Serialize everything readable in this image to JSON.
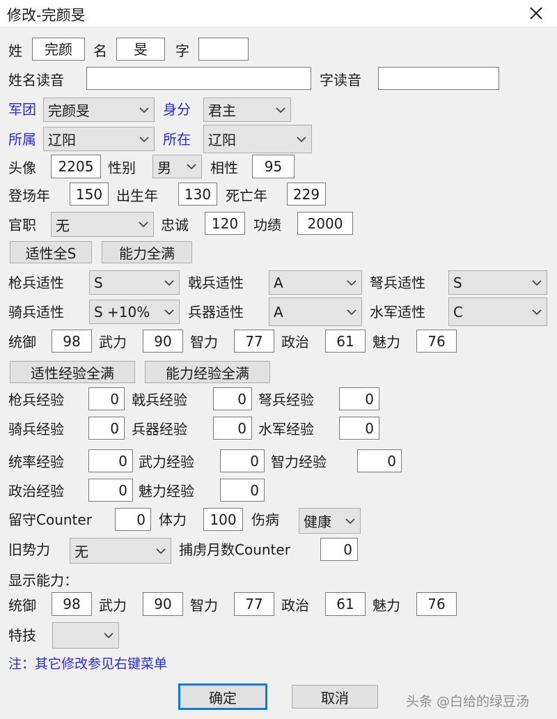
{
  "window": {
    "title": "修改-完颜旻",
    "close_icon": "close-icon"
  },
  "name_row": {
    "surname_label": "姓",
    "surname_value": "完颜",
    "given_label": "名",
    "given_value": "旻",
    "courtesy_label": "字",
    "courtesy_value": ""
  },
  "pronunciation_row": {
    "name_reading_label": "姓名读音",
    "name_reading_value": "",
    "courtesy_reading_label": "字读音",
    "courtesy_reading_value": ""
  },
  "affiliation": {
    "corps_label": "军团",
    "corps_value": "完颜旻",
    "identity_label": "身分",
    "identity_value": "君主",
    "belong_label": "所属",
    "belong_value": "辽阳",
    "location_label": "所在",
    "location_value": "辽阳"
  },
  "portrait_row": {
    "portrait_label": "头像",
    "portrait_value": "2205",
    "gender_label": "性别",
    "gender_value": "男",
    "compat_label": "相性",
    "compat_value": "95"
  },
  "years_row": {
    "debut_label": "登场年",
    "debut_value": "150",
    "birth_label": "出生年",
    "birth_value": "130",
    "death_label": "死亡年",
    "death_value": "229"
  },
  "office_row": {
    "office_label": "官职",
    "office_value": "无",
    "loyalty_label": "忠诚",
    "loyalty_value": "120",
    "merit_label": "功绩",
    "merit_value": "2000"
  },
  "quick_buttons": {
    "all_s_label": "适性全S",
    "all_full_label": "能力全满"
  },
  "aptitudes": [
    {
      "label": "枪兵适性",
      "value": "S"
    },
    {
      "label": "戟兵适性",
      "value": "A"
    },
    {
      "label": "弩兵适性",
      "value": "S"
    },
    {
      "label": "骑兵适性",
      "value": "S +10%"
    },
    {
      "label": "兵器适性",
      "value": "A"
    },
    {
      "label": "水军适性",
      "value": "C"
    }
  ],
  "abilities": [
    {
      "label": "统御",
      "value": "98"
    },
    {
      "label": "武力",
      "value": "90"
    },
    {
      "label": "智力",
      "value": "77"
    },
    {
      "label": "政治",
      "value": "61"
    },
    {
      "label": "魅力",
      "value": "76"
    }
  ],
  "exp_buttons": {
    "apt_exp_full_label": "适性经验全满",
    "abi_exp_full_label": "能力经验全满"
  },
  "aptitude_exp": [
    {
      "label": "枪兵经验",
      "value": "0"
    },
    {
      "label": "戟兵经验",
      "value": "0"
    },
    {
      "label": "弩兵经验",
      "value": "0"
    },
    {
      "label": "骑兵经验",
      "value": "0"
    },
    {
      "label": "兵器经验",
      "value": "0"
    },
    {
      "label": "水军经验",
      "value": "0"
    }
  ],
  "ability_exp": [
    {
      "label": "统率经验",
      "value": "0"
    },
    {
      "label": "武力经验",
      "value": "0"
    },
    {
      "label": "智力经验",
      "value": "0"
    },
    {
      "label": "政治经验",
      "value": "0"
    },
    {
      "label": "魅力经验",
      "value": "0"
    }
  ],
  "status_row": {
    "garrison_label": "留守Counter",
    "garrison_value": "0",
    "stamina_label": "体力",
    "stamina_value": "100",
    "injury_label": "伤病",
    "injury_value": "健康",
    "old_force_label": "旧势力",
    "old_force_value": "无",
    "captive_label": "捕虏月数Counter",
    "captive_value": "0"
  },
  "display_section": {
    "heading": "显示能力：",
    "abilities": [
      {
        "label": "统御",
        "value": "98"
      },
      {
        "label": "武力",
        "value": "90"
      },
      {
        "label": "智力",
        "value": "77"
      },
      {
        "label": "政治",
        "value": "61"
      },
      {
        "label": "魅力",
        "value": "76"
      }
    ],
    "skill_label": "特技",
    "skill_value": ""
  },
  "footer": {
    "note": "注：其它修改参见右键菜单",
    "ok_label": "确定",
    "cancel_label": "取消",
    "watermark": "头条 @白给的绿豆汤"
  },
  "colors": {
    "accent_blue": "#2b2bcf",
    "focus_blue": "#0a7cd4",
    "page_bg": "#f0f0f0",
    "field_bg": "#ffffff",
    "dropdown_bg": "#e4e4e4"
  }
}
